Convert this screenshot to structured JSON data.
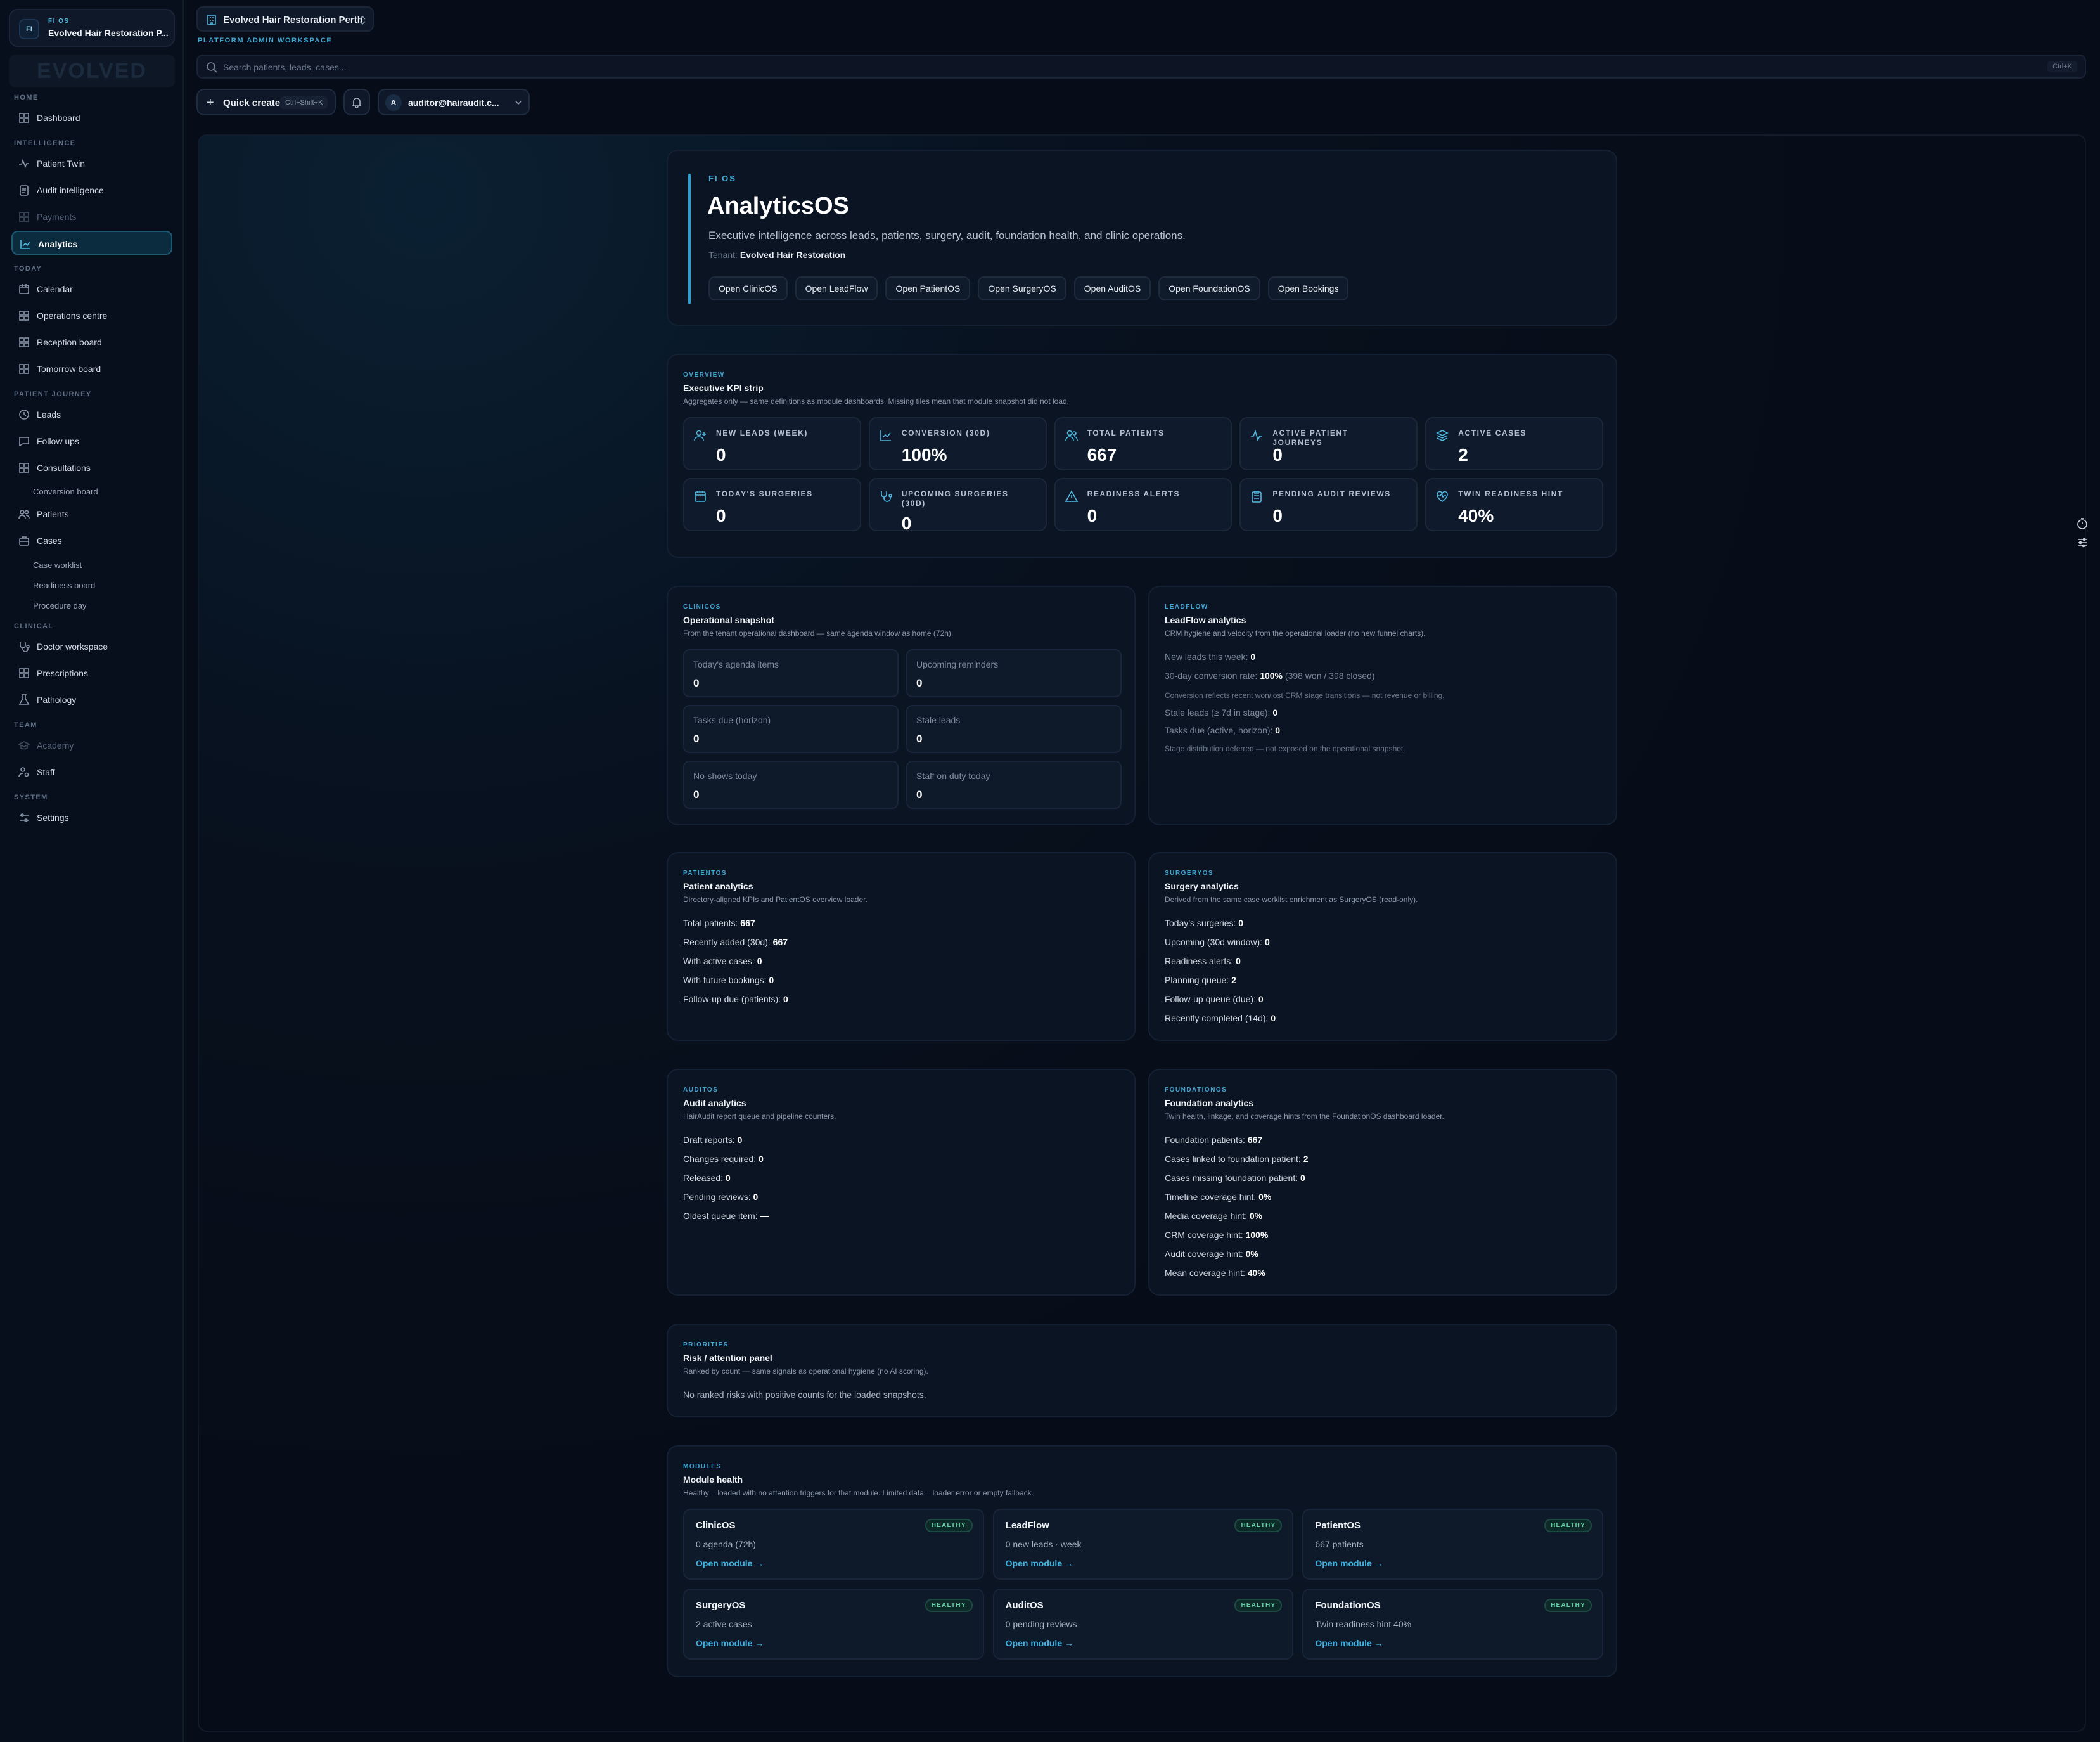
{
  "tenant": {
    "kicker": "FI OS",
    "name": "Evolved Hair Restoration P...",
    "badge": "FI",
    "logo_text": "EVOLVED"
  },
  "sidebar": {
    "sections": {
      "home": "HOME",
      "intelligence": "INTELLIGENCE",
      "today": "TODAY",
      "patient_journey": "PATIENT JOURNEY",
      "clinical": "CLINICAL",
      "team": "TEAM",
      "system": "SYSTEM"
    },
    "items": {
      "dashboard": "Dashboard",
      "patient_twin": "Patient Twin",
      "audit_intelligence": "Audit intelligence",
      "payments": "Payments",
      "analytics": "Analytics",
      "calendar": "Calendar",
      "operations_centre": "Operations centre",
      "reception_board": "Reception board",
      "tomorrow_board": "Tomorrow board",
      "leads": "Leads",
      "follow_ups": "Follow ups",
      "consultations": "Consultations",
      "conversion_board": "Conversion board",
      "patients": "Patients",
      "cases": "Cases",
      "case_worklist": "Case worklist",
      "readiness_board": "Readiness board",
      "procedure_day": "Procedure day",
      "doctor_workspace": "Doctor workspace",
      "prescriptions": "Prescriptions",
      "pathology": "Pathology",
      "academy": "Academy",
      "staff": "Staff",
      "settings": "Settings"
    }
  },
  "topbar": {
    "workspace": "Evolved Hair Restoration Perth",
    "workspace_kicker": "PLATFORM ADMIN WORKSPACE",
    "search_placeholder": "Search patients, leads, cases...",
    "search_shortcut": "Ctrl+K",
    "quick_create": "Quick create",
    "quick_create_shortcut": "Ctrl+Shift+K",
    "user_initial": "A",
    "user_email": "auditor@hairaudit.c..."
  },
  "hero": {
    "kicker": "FI OS",
    "title": "AnalyticsOS",
    "description": "Executive intelligence across leads, patients, surgery, audit, foundation health, and clinic operations.",
    "tenant_label": "Tenant:",
    "tenant_name": "Evolved Hair Restoration",
    "buttons": [
      "Open ClinicOS",
      "Open LeadFlow",
      "Open PatientOS",
      "Open SurgeryOS",
      "Open AuditOS",
      "Open FoundationOS",
      "Open Bookings"
    ]
  },
  "kpi": {
    "kicker": "OVERVIEW",
    "title": "Executive KPI strip",
    "subtitle": "Aggregates only — same definitions as module dashboards. Missing tiles mean that module snapshot did not load.",
    "tiles": [
      {
        "label": "NEW LEADS (WEEK)",
        "value": "0"
      },
      {
        "label": "CONVERSION (30D)",
        "value": "100%"
      },
      {
        "label": "TOTAL PATIENTS",
        "value": "667"
      },
      {
        "label": "ACTIVE PATIENT JOURNEYS",
        "value": "0"
      },
      {
        "label": "ACTIVE CASES",
        "value": "2"
      },
      {
        "label": "TODAY'S SURGERIES",
        "value": "0"
      },
      {
        "label": "UPCOMING SURGERIES (30D)",
        "value": "0"
      },
      {
        "label": "READINESS ALERTS",
        "value": "0"
      },
      {
        "label": "PENDING AUDIT REVIEWS",
        "value": "0"
      },
      {
        "label": "TWIN READINESS HINT",
        "value": "40%"
      }
    ]
  },
  "clinicos": {
    "kicker": "CLINICOS",
    "title": "Operational snapshot",
    "subtitle": "From the tenant operational dashboard — same agenda window as home (72h).",
    "tiles": [
      {
        "label": "Today's agenda items",
        "value": "0"
      },
      {
        "label": "Upcoming reminders",
        "value": "0"
      },
      {
        "label": "Tasks due (horizon)",
        "value": "0"
      },
      {
        "label": "Stale leads",
        "value": "0"
      },
      {
        "label": "No-shows today",
        "value": "0"
      },
      {
        "label": "Staff on duty today",
        "value": "0"
      }
    ]
  },
  "leadflow": {
    "kicker": "LEADFLOW",
    "title": "LeadFlow analytics",
    "subtitle": "CRM hygiene and velocity from the operational loader (no new funnel charts).",
    "new_leads_label": "New leads this week:",
    "new_leads_value": "0",
    "conversion_label": "30-day conversion rate:",
    "conversion_value": "100%",
    "conversion_detail": "(398 won / 398 closed)",
    "conversion_note": "Conversion reflects recent won/lost CRM stage transitions — not revenue or billing.",
    "stale_label": "Stale leads (≥ 7d in stage):",
    "stale_value": "0",
    "tasks_label": "Tasks due (active, horizon):",
    "tasks_value": "0",
    "stage_note": "Stage distribution deferred — not exposed on the operational snapshot."
  },
  "patientos": {
    "kicker": "PATIENTOS",
    "title": "Patient analytics",
    "subtitle": "Directory-aligned KPIs and PatientOS overview loader.",
    "rows": [
      {
        "label": "Total patients:",
        "value": "667"
      },
      {
        "label": "Recently added (30d):",
        "value": "667"
      },
      {
        "label": "With active cases:",
        "value": "0"
      },
      {
        "label": "With future bookings:",
        "value": "0"
      },
      {
        "label": "Follow-up due (patients):",
        "value": "0"
      }
    ]
  },
  "surgeryos": {
    "kicker": "SURGERYOS",
    "title": "Surgery analytics",
    "subtitle": "Derived from the same case worklist enrichment as SurgeryOS (read-only).",
    "rows": [
      {
        "label": "Today's surgeries:",
        "value": "0"
      },
      {
        "label": "Upcoming (30d window):",
        "value": "0"
      },
      {
        "label": "Readiness alerts:",
        "value": "0"
      },
      {
        "label": "Planning queue:",
        "value": "2"
      },
      {
        "label": "Follow-up queue (due):",
        "value": "0"
      },
      {
        "label": "Recently completed (14d):",
        "value": "0"
      }
    ]
  },
  "auditos": {
    "kicker": "AUDITOS",
    "title": "Audit analytics",
    "subtitle": "HairAudit report queue and pipeline counters.",
    "rows": [
      {
        "label": "Draft reports:",
        "value": "0"
      },
      {
        "label": "Changes required:",
        "value": "0"
      },
      {
        "label": "Released:",
        "value": "0"
      },
      {
        "label": "Pending reviews:",
        "value": "0"
      },
      {
        "label": "Oldest queue item:",
        "value": "—"
      }
    ]
  },
  "foundationos": {
    "kicker": "FOUNDATIONOS",
    "title": "Foundation analytics",
    "subtitle": "Twin health, linkage, and coverage hints from the FoundationOS dashboard loader.",
    "rows": [
      {
        "label": "Foundation patients:",
        "value": "667"
      },
      {
        "label": "Cases linked to foundation patient:",
        "value": "2"
      },
      {
        "label": "Cases missing foundation patient:",
        "value": "0"
      },
      {
        "label": "Timeline coverage hint:",
        "value": "0%"
      },
      {
        "label": "Media coverage hint:",
        "value": "0%"
      },
      {
        "label": "CRM coverage hint:",
        "value": "100%"
      },
      {
        "label": "Audit coverage hint:",
        "value": "0%"
      },
      {
        "label": "Mean coverage hint:",
        "value": "40%"
      }
    ]
  },
  "priorities": {
    "kicker": "PRIORITIES",
    "title": "Risk / attention panel",
    "subtitle": "Ranked by count — same signals as operational hygiene (no AI scoring).",
    "empty": "No ranked risks with positive counts for the loaded snapshots."
  },
  "modules": {
    "kicker": "MODULES",
    "title": "Module health",
    "subtitle": "Healthy = loaded with no attention triggers for that module. Limited data = loader error or empty fallback.",
    "tiles": [
      {
        "name": "ClinicOS",
        "status": "HEALTHY",
        "summary": "0 agenda (72h)",
        "link": "Open module →"
      },
      {
        "name": "LeadFlow",
        "status": "HEALTHY",
        "summary": "0 new leads · week",
        "link": "Open module →"
      },
      {
        "name": "PatientOS",
        "status": "HEALTHY",
        "summary": "667 patients",
        "link": "Open module →"
      },
      {
        "name": "SurgeryOS",
        "status": "HEALTHY",
        "summary": "2 active cases",
        "link": "Open module →"
      },
      {
        "name": "AuditOS",
        "status": "HEALTHY",
        "summary": "0 pending reviews",
        "link": "Open module →"
      },
      {
        "name": "FoundationOS",
        "status": "HEALTHY",
        "summary": "Twin readiness hint 40%",
        "link": "Open module →"
      }
    ]
  },
  "colors": {
    "accent": "#3fa8d4",
    "background": "#070d18",
    "healthy": "#5fd3a6"
  }
}
